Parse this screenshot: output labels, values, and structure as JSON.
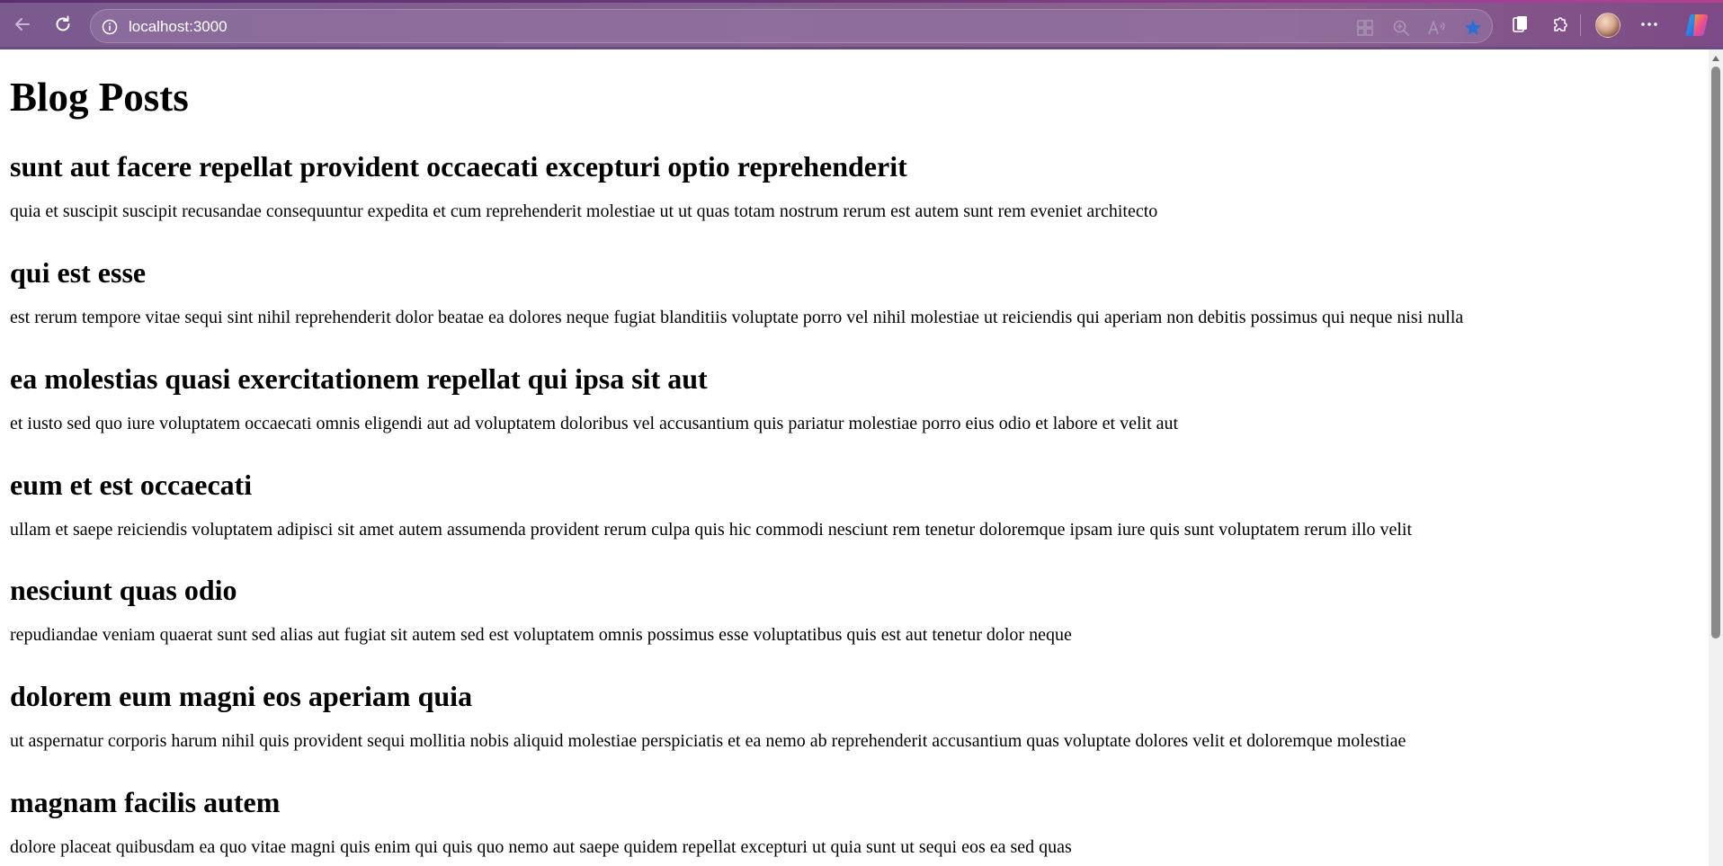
{
  "browser": {
    "url": "localhost:3000",
    "colors": {
      "toolbar": "#84628f",
      "accent": "#2b6fd6"
    },
    "icons": {
      "back": "arrow-left-icon",
      "refresh": "refresh-icon",
      "site_info": "info-icon",
      "app_available": "app-grid-icon",
      "zoom": "zoom-icon",
      "read_aloud": "read-aloud-icon",
      "favorite": "star-icon",
      "collections": "collections-icon",
      "extensions": "puzzle-icon",
      "profile": "avatar",
      "more": "ellipsis-icon",
      "copilot": "copilot-icon"
    }
  },
  "page": {
    "title": "Blog Posts",
    "posts": [
      {
        "title": "sunt aut facere repellat provident occaecati excepturi optio reprehenderit",
        "body": "quia et suscipit suscipit recusandae consequuntur expedita et cum reprehenderit molestiae ut ut quas totam nostrum rerum est autem sunt rem eveniet architecto"
      },
      {
        "title": "qui est esse",
        "body": "est rerum tempore vitae sequi sint nihil reprehenderit dolor beatae ea dolores neque fugiat blanditiis voluptate porro vel nihil molestiae ut reiciendis qui aperiam non debitis possimus qui neque nisi nulla"
      },
      {
        "title": "ea molestias quasi exercitationem repellat qui ipsa sit aut",
        "body": "et iusto sed quo iure voluptatem occaecati omnis eligendi aut ad voluptatem doloribus vel accusantium quis pariatur molestiae porro eius odio et labore et velit aut"
      },
      {
        "title": "eum et est occaecati",
        "body": "ullam et saepe reiciendis voluptatem adipisci sit amet autem assumenda provident rerum culpa quis hic commodi nesciunt rem tenetur doloremque ipsam iure quis sunt voluptatem rerum illo velit"
      },
      {
        "title": "nesciunt quas odio",
        "body": "repudiandae veniam quaerat sunt sed alias aut fugiat sit autem sed est voluptatem omnis possimus esse voluptatibus quis est aut tenetur dolor neque"
      },
      {
        "title": "dolorem eum magni eos aperiam quia",
        "body": "ut aspernatur corporis harum nihil quis provident sequi mollitia nobis aliquid molestiae perspiciatis et ea nemo ab reprehenderit accusantium quas voluptate dolores velit et doloremque molestiae"
      },
      {
        "title": "magnam facilis autem",
        "body": "dolore placeat quibusdam ea quo vitae magni quis enim qui quis quo nemo aut saepe quidem repellat excepturi ut quia sunt ut sequi eos ea sed quas"
      }
    ]
  }
}
